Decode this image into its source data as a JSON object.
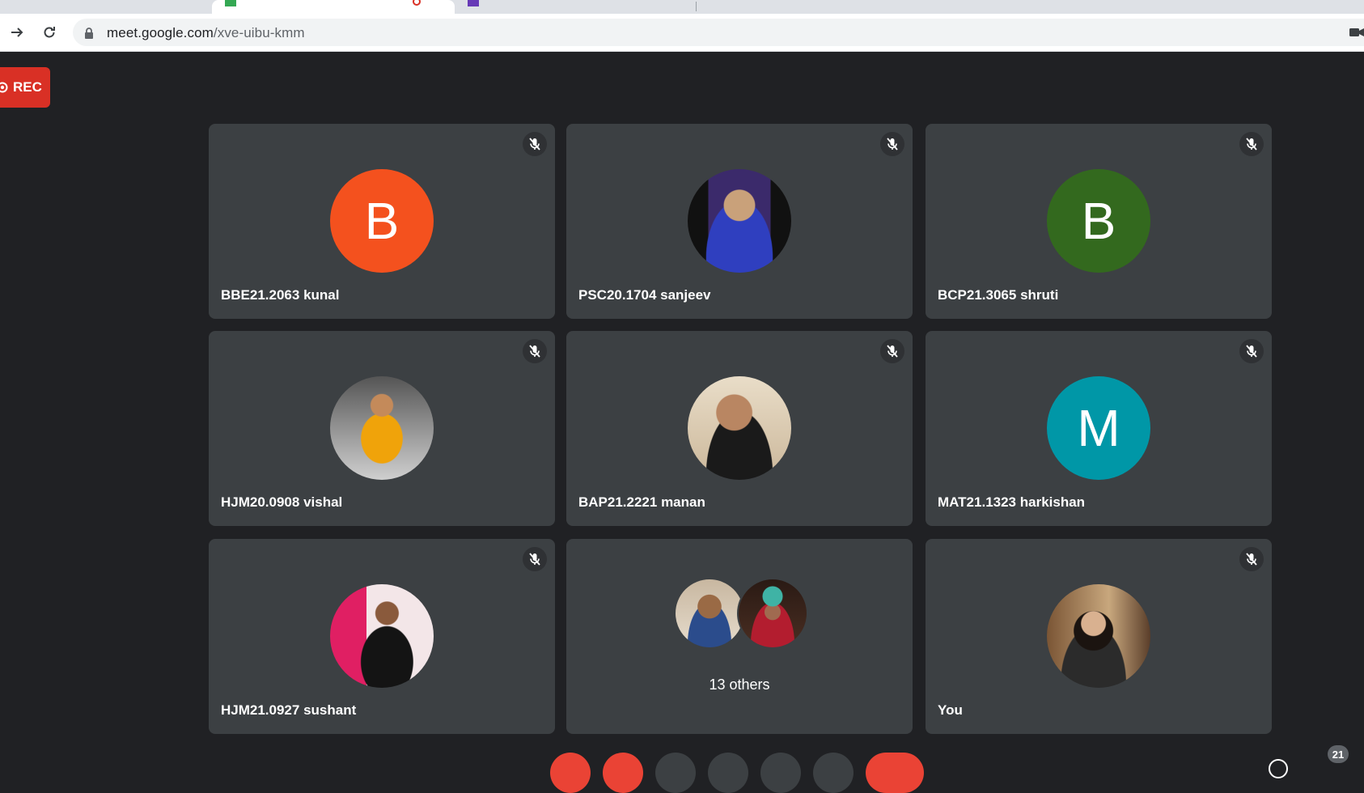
{
  "browser": {
    "url_host": "meet.google.com",
    "url_path": "/xve-uibu-kmm"
  },
  "recording": {
    "label": "REC"
  },
  "colors": {
    "accent_red": "#d93025",
    "tile_bg": "#3c4043",
    "page_bg": "#202124"
  },
  "participants": [
    {
      "name": "BBE21.2063 kunal",
      "initial": "B",
      "avatar_color": "#f4511e",
      "muted": true
    },
    {
      "name": "PSC20.1704 sanjeev",
      "initial": "",
      "avatar_color": "#2a3a8c",
      "muted": true,
      "photo": true
    },
    {
      "name": "BCP21.3065 shruti",
      "initial": "B",
      "avatar_color": "#33691e",
      "muted": true
    },
    {
      "name": "HJM20.0908 vishal",
      "initial": "",
      "avatar_color": "#b8860b",
      "muted": true,
      "photo": true
    },
    {
      "name": "BAP21.2221 manan",
      "initial": "",
      "avatar_color": "#5d4037",
      "muted": true,
      "photo": true
    },
    {
      "name": "MAT21.1323 harkishan",
      "initial": "M",
      "avatar_color": "#0097a7",
      "muted": true
    },
    {
      "name": "HJM21.0927 sushant",
      "initial": "",
      "avatar_color": "#8e2449",
      "muted": true,
      "photo": true
    },
    {
      "name": "13 others",
      "initial": "",
      "avatar_color": "#3c4043",
      "muted": false
    },
    {
      "name": "You",
      "initial": "",
      "avatar_color": "#6d4c41",
      "muted": true,
      "photo": true
    }
  ],
  "others": {
    "label": "13 others"
  },
  "footer": {
    "participant_count": "21"
  }
}
